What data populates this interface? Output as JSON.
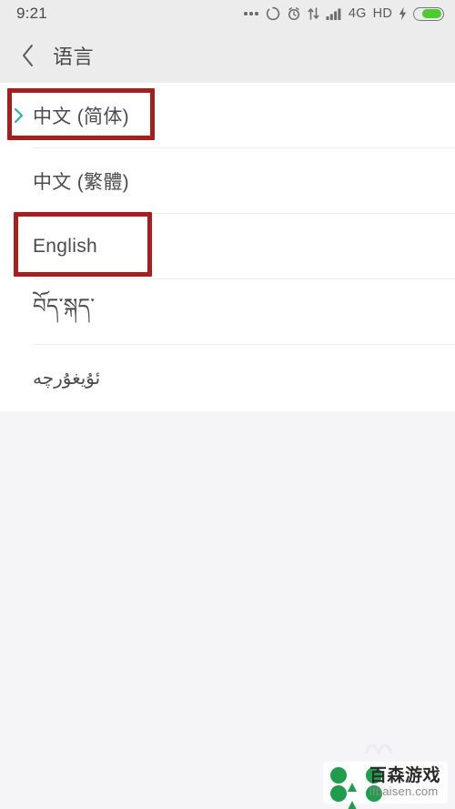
{
  "statusbar": {
    "time": "9:21",
    "icons": [
      {
        "name": "more-dots-icon",
        "glyph": "..."
      },
      {
        "name": "sync-circle-icon",
        "glyph": "○"
      },
      {
        "name": "alarm-clock-icon",
        "glyph": "⏰"
      },
      {
        "name": "data-transfer-icon",
        "glyph": "⇅"
      },
      {
        "name": "signal-bars-icon",
        "glyph": "▂▄▆█"
      }
    ],
    "network_label": "4G",
    "hd_label": "HD",
    "charging_glyph": "⚡",
    "battery_level_percent": 76,
    "battery_color": "#4ecb2f",
    "background_color": "#ececec"
  },
  "header": {
    "back_label": "‹",
    "title": "语言",
    "background_color": "#ececec",
    "text_color": "#4a4a4a"
  },
  "list": {
    "background_color": "#ffffff",
    "selected_index": 0,
    "selected_marker_color": "#2cb3a6",
    "items": [
      {
        "label": "中文 (简体)",
        "name": "language-item-chinese-simplified",
        "selected": true,
        "script": "latin"
      },
      {
        "label": "中文 (繁體)",
        "name": "language-item-chinese-traditional",
        "selected": false,
        "script": "latin"
      },
      {
        "label": "English",
        "name": "language-item-english",
        "selected": false,
        "script": "latin"
      },
      {
        "label": "བོད་སྐད་",
        "name": "language-item-tibetan",
        "selected": false,
        "script": "tibetan"
      },
      {
        "label": "ئۇيغۇرچە",
        "name": "language-item-uyghur",
        "selected": false,
        "script": "uyghur"
      }
    ]
  },
  "annotations": {
    "color": "#a81d1d",
    "boxes": [
      {
        "name": "highlight-box-chinese-simplified",
        "target": "中文 (简体)"
      },
      {
        "name": "highlight-box-english",
        "target": "English"
      }
    ]
  },
  "watermark": {
    "brand_cn": "百森游戏",
    "url": "lfbaisen.com",
    "logo_color": "#1f9d4d"
  },
  "page": {
    "background_color": "#f5f4f7"
  }
}
